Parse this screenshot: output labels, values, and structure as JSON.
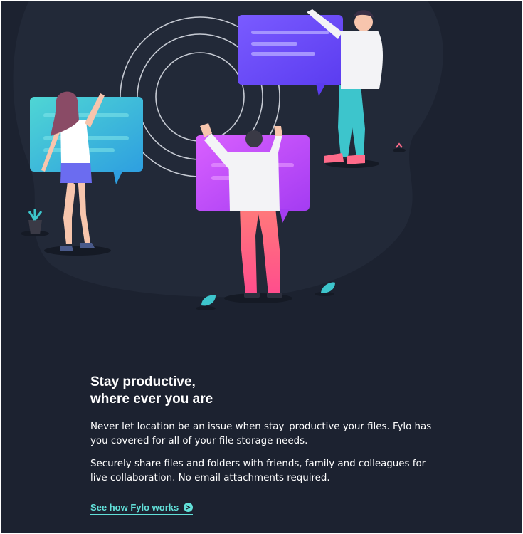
{
  "section": {
    "heading_line1": "Stay productive,",
    "heading_line2": "where ever you are",
    "paragraph1": "Never let location be an issue when stay_productive your files. Fylo has you covered for all of your file storage needs.",
    "paragraph2": "Securely share files and folders with friends, family and colleagues for live collaboration. No email attachments required.",
    "cta_label": "See how Fylo works",
    "cta_icon": "arrow-right-circle-icon"
  },
  "colors": {
    "background": "#1c2230",
    "accent": "#62e0d9",
    "text": "#ffffff"
  }
}
